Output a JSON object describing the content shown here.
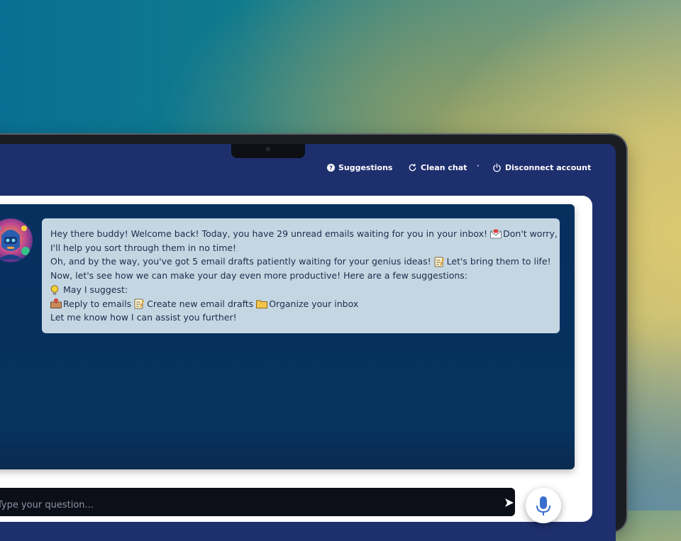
{
  "header": {
    "nav": [
      {
        "label": "Suggestions",
        "icon": "question-circle-icon"
      },
      {
        "label": "Clean chat",
        "icon": "refresh-icon"
      },
      {
        "label": "Disconnect account",
        "icon": "power-icon"
      }
    ],
    "separator": "·"
  },
  "chat": {
    "message": {
      "avatar": "robot-avatar",
      "lines": [
        {
          "text": "Hey there buddy! Welcome back! Today, you have 29 unread emails waiting for you in your inbox!",
          "trail_icon": "envelope-icon",
          "trail_text": "Don't worry,"
        },
        {
          "text": "I'll help you sort through them in no time!"
        },
        {
          "text": "Oh, and by the way, you've got 5 email drafts patiently waiting for your genius ideas!",
          "trail_icon": "memo-icon",
          "trail_text": "Let's bring them to life!"
        },
        {
          "text": "Now, let's see how we can make your day even more productive! Here are a few suggestions:"
        },
        {
          "lead_icon": "lightbulb-icon",
          "text": "May I suggest:"
        }
      ],
      "suggestions": [
        {
          "icon": "outbox-icon",
          "label": "Reply to emails"
        },
        {
          "icon": "memo-icon",
          "label": "Create new email drafts"
        },
        {
          "icon": "folder-icon",
          "label": "Organize your inbox"
        }
      ],
      "closing": "Let me know how I can assist you further!"
    }
  },
  "composer": {
    "placeholder": "Type your question...",
    "send_icon": "send-arrow-icon",
    "mic_icon": "microphone-icon"
  },
  "colors": {
    "screen_bg": "#1e2f6e",
    "chat_bg": "#07305f",
    "bubble_bg": "#c5d6e3",
    "bubble_text": "#1b2d4a",
    "mic_accent": "#3a6fd0"
  }
}
